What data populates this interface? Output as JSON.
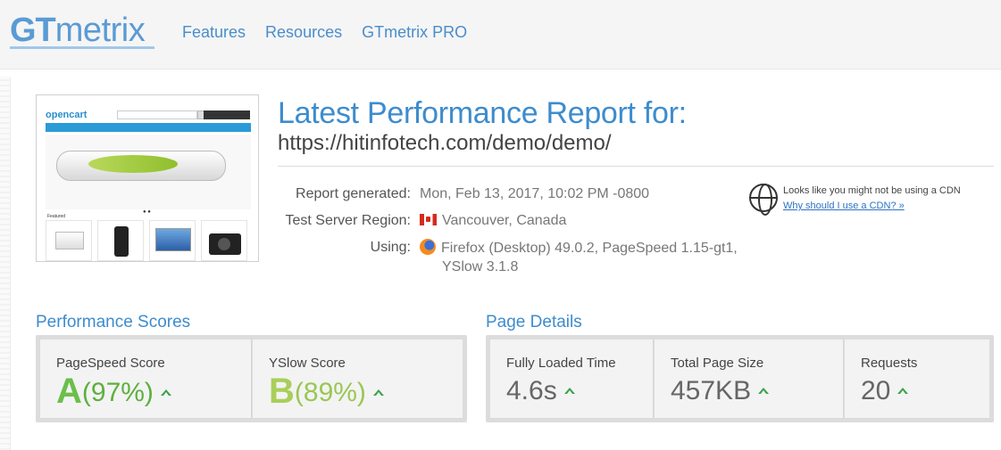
{
  "header": {
    "logo_gt": "GT",
    "logo_metrix": "metrix",
    "nav": [
      "Features",
      "Resources",
      "GTmetrix PRO"
    ]
  },
  "thumbnail": {
    "site_logo": "opencart",
    "featured_label": "Featured",
    "carousel_dots": "● ●"
  },
  "report": {
    "title": "Latest Performance Report for:",
    "url": "https://hitinfotech.com/demo/demo/",
    "generated_label": "Report generated:",
    "generated_value": "Mon, Feb 13, 2017, 10:02 PM -0800",
    "region_label": "Test Server Region:",
    "region_value": "Vancouver, Canada",
    "using_label": "Using:",
    "using_value_line1": "Firefox (Desktop) 49.0.2, PageSpeed 1.15-gt1,",
    "using_value_line2": "YSlow 3.1.8",
    "cdn_notice": "Looks like you might not be using a CDN",
    "cdn_link": "Why should I use a CDN? »"
  },
  "performance": {
    "title": "Performance Scores",
    "pagespeed_label": "PageSpeed Score",
    "pagespeed_grade": "A",
    "pagespeed_pct": "(97%)",
    "yslow_label": "YSlow Score",
    "yslow_grade": "B",
    "yslow_pct": "(89%)"
  },
  "details": {
    "title": "Page Details",
    "load_label": "Fully Loaded Time",
    "load_value": "4.6s",
    "size_label": "Total Page Size",
    "size_value": "457KB",
    "requests_label": "Requests",
    "requests_value": "20"
  },
  "colors": {
    "accent": "#3d8ccd",
    "grade_a": "#6bbf4b",
    "grade_b": "#a8cf5a",
    "up_arrow": "#3aa34a"
  }
}
